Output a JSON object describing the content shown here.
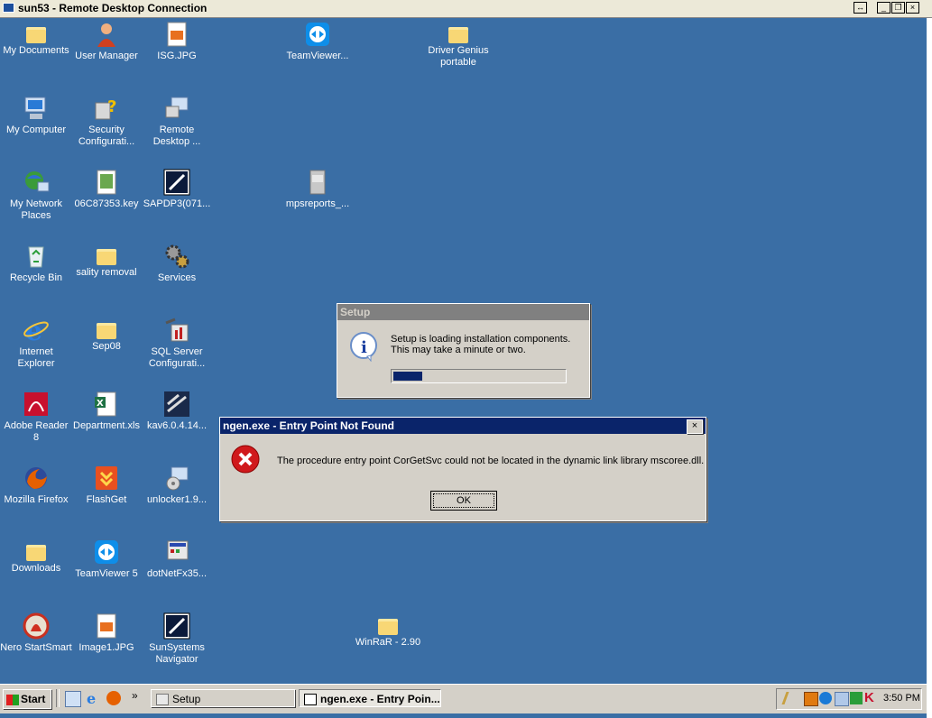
{
  "window": {
    "title": "sun53 - Remote Desktop Connection"
  },
  "desktop_icons": [
    {
      "label": "My Documents"
    },
    {
      "label": "User Manager"
    },
    {
      "label": "ISG.JPG"
    },
    {
      "label": "TeamViewer..."
    },
    {
      "label": "Driver Genius portable"
    },
    {
      "label": "My Computer"
    },
    {
      "label": "Security Configurati..."
    },
    {
      "label": "Remote Desktop ..."
    },
    {
      "label": "My Network Places"
    },
    {
      "label": "06C87353.key"
    },
    {
      "label": "SAPDP3(071..."
    },
    {
      "label": "mpsreports_..."
    },
    {
      "label": "Recycle Bin"
    },
    {
      "label": "sality removal"
    },
    {
      "label": "Services"
    },
    {
      "label": "Internet Explorer"
    },
    {
      "label": "Sep08"
    },
    {
      "label": "SQL Server Configurati..."
    },
    {
      "label": "Adobe Reader 8"
    },
    {
      "label": "Department.xls"
    },
    {
      "label": "kav6.0.4.14..."
    },
    {
      "label": "Mozilla Firefox"
    },
    {
      "label": "FlashGet"
    },
    {
      "label": "unlocker1.9..."
    },
    {
      "label": "Downloads"
    },
    {
      "label": "TeamViewer 5"
    },
    {
      "label": "dotNetFx35..."
    },
    {
      "label": "Nero StartSmart"
    },
    {
      "label": "Image1.JPG"
    },
    {
      "label": "SunSystems Navigator"
    },
    {
      "label": "WinRaR - 2.90"
    }
  ],
  "setup_dialog": {
    "title": "Setup",
    "line1": "Setup is loading installation components.",
    "line2": "This may take a minute or two.",
    "progress": 0.17
  },
  "error_dialog": {
    "title": "ngen.exe - Entry Point Not Found",
    "message": "The procedure entry point CorGetSvc could not be located in the dynamic link library mscoree.dll.",
    "ok_label": "OK",
    "close_label": "×"
  },
  "taskbar": {
    "start_label": "Start",
    "chevron": "»",
    "buttons": [
      {
        "label": "Setup"
      },
      {
        "label": "ngen.exe - Entry Poin..."
      }
    ],
    "clock": "3:50 PM"
  },
  "colors": {
    "desktop": "#3a6ea5",
    "active_caption": "#0a246a",
    "inactive_caption": "#808080",
    "error_red": "#d0191c"
  }
}
